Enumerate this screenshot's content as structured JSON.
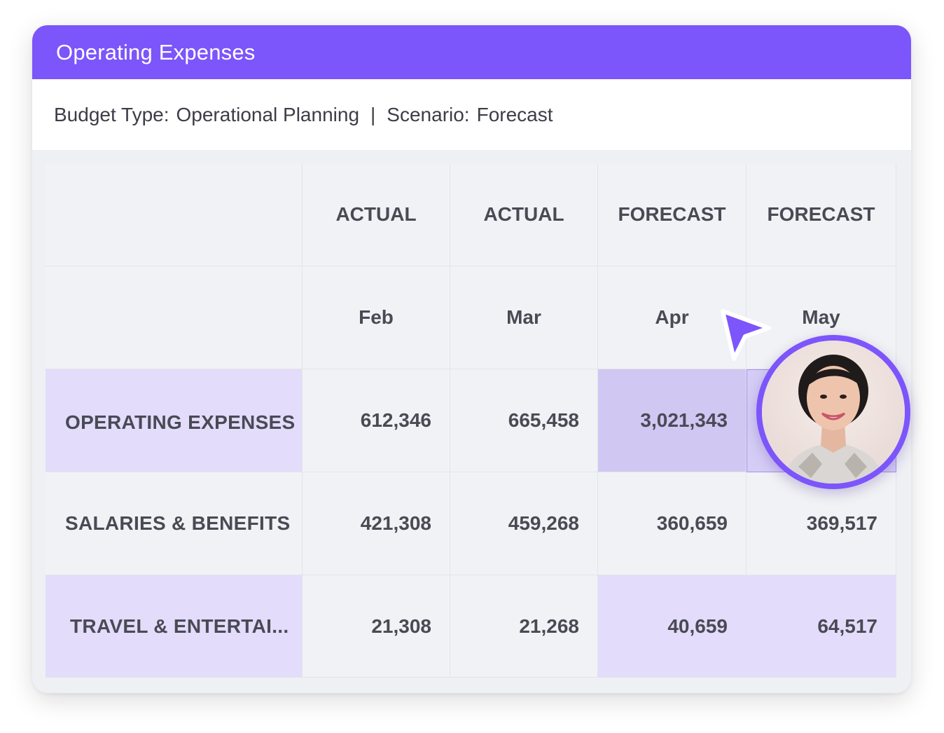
{
  "panel": {
    "title": "Operating Expenses",
    "budget_type_label": "Budget Type:",
    "budget_type_value": "Operational Planning",
    "separator": "|",
    "scenario_label": "Scenario:",
    "scenario_value": "Forecast"
  },
  "table": {
    "columns": [
      {
        "type": "ACTUAL",
        "month": "Feb"
      },
      {
        "type": "ACTUAL",
        "month": "Mar"
      },
      {
        "type": "FORECAST",
        "month": "Apr"
      },
      {
        "type": "FORECAST",
        "month": "May"
      }
    ],
    "rows": [
      {
        "label": "OPERATING EXPENSES",
        "values": [
          "612,346",
          "665,458",
          "3,021,343",
          ""
        ]
      },
      {
        "label": "SALARIES & BENEFITS",
        "values": [
          "421,308",
          "459,268",
          "360,659",
          "369,517"
        ]
      },
      {
        "label": "TRAVEL & ENTERTAI...",
        "values": [
          "21,308",
          "21,268",
          "40,659",
          "64,517"
        ]
      }
    ]
  },
  "colors": {
    "accent": "#7c55fb",
    "row_highlight": "#e3dcfb",
    "cell_highlight": "#d1c7f3"
  },
  "icons": {
    "cursor": "cursor-pointer-icon",
    "avatar": "user-avatar"
  }
}
